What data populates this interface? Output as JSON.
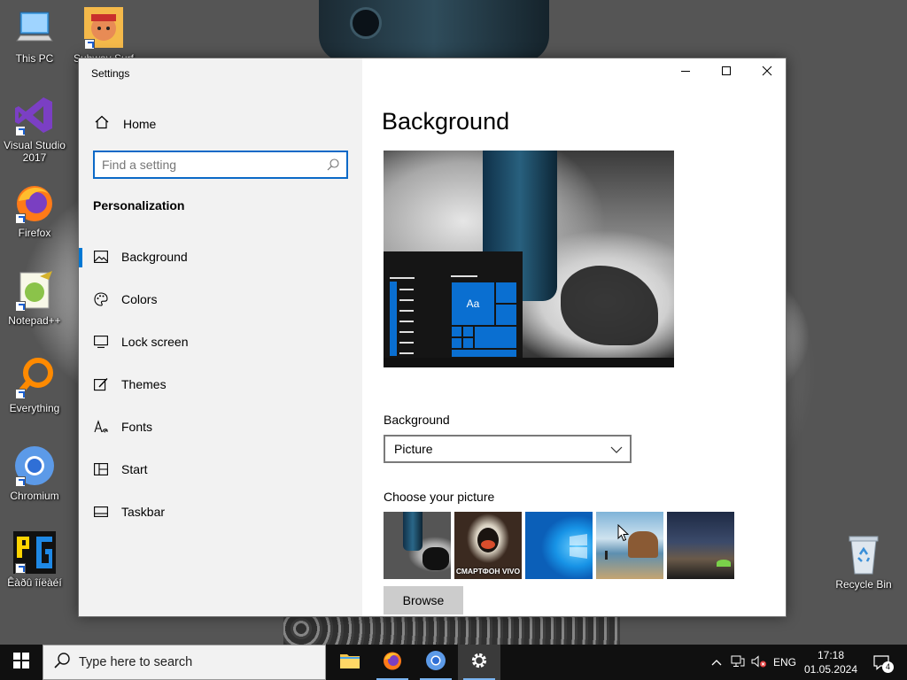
{
  "desktop": {
    "icons": [
      {
        "label": "This PC"
      },
      {
        "label": "Subway Surf"
      },
      {
        "label": "Visual Studio 2017"
      },
      {
        "label": "Firefox"
      },
      {
        "label": "Notepad++"
      },
      {
        "label": "Everything"
      },
      {
        "label": "Chromium"
      },
      {
        "label": "Êàðû îíëàéí"
      },
      {
        "label": "Recycle Bin"
      }
    ]
  },
  "window": {
    "app_title": "Settings",
    "controls": {
      "minimize": "minimize-icon",
      "maximize": "maximize-icon",
      "close": "close-icon"
    }
  },
  "sidebar": {
    "home_label": "Home",
    "search_placeholder": "Find a setting",
    "section_label": "Personalization",
    "items": [
      {
        "label": "Background",
        "icon": "picture-icon",
        "active": true
      },
      {
        "label": "Colors",
        "icon": "palette-icon",
        "active": false
      },
      {
        "label": "Lock screen",
        "icon": "lock-screen-icon",
        "active": false
      },
      {
        "label": "Themes",
        "icon": "themes-icon",
        "active": false
      },
      {
        "label": "Fonts",
        "icon": "fonts-icon",
        "active": false
      },
      {
        "label": "Start",
        "icon": "start-icon",
        "active": false
      },
      {
        "label": "Taskbar",
        "icon": "taskbar-icon",
        "active": false
      }
    ]
  },
  "main": {
    "title": "Background",
    "preview_tile_text": "Aa",
    "background_label": "Background",
    "background_value": "Picture",
    "choose_picture_label": "Choose your picture",
    "thumb_2_caption": "СМАРТФОН VIVO",
    "browse_label": "Browse"
  },
  "taskbar": {
    "search_placeholder": "Type here to search",
    "language": "ENG",
    "time": "17:18",
    "date": "01.05.2024",
    "notification_count": "4"
  },
  "colors": {
    "accent": "#0078d4",
    "taskbar": "#101010",
    "sidebar_bg": "#f2f2f2"
  }
}
